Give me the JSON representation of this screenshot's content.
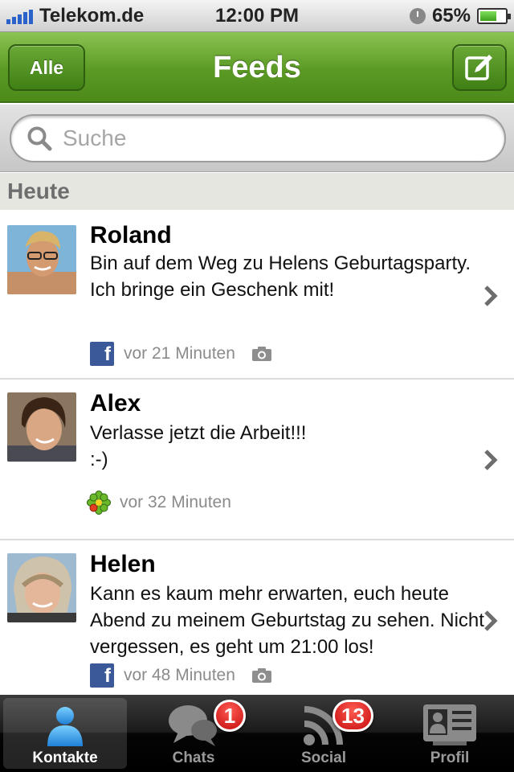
{
  "status_bar": {
    "carrier": "Telekom.de",
    "time": "12:00 PM",
    "battery": "65%",
    "battery_level": 0.65
  },
  "nav": {
    "left_button": "Alle",
    "title": "Feeds",
    "right_icon": "compose-icon"
  },
  "search": {
    "placeholder": "Suche",
    "value": ""
  },
  "section": {
    "title": "Heute"
  },
  "feed": [
    {
      "name": "Roland",
      "message": "Bin auf dem Weg zu Helens Geburtagsparty. Ich bringe ein Geschenk mit!",
      "time": "vor 21 Minuten",
      "source_icon": "facebook-icon",
      "has_photo": true
    },
    {
      "name": "Alex",
      "message": "Verlasse jetzt die Arbeit!!!\n:-)",
      "time": "vor 32 Minuten",
      "source_icon": "icq-flower-icon",
      "has_photo": false
    },
    {
      "name": "Helen",
      "message": "Kann es kaum mehr erwarten, euch heute Abend zu meinem Geburtstag zu sehen. Nicht vergessen, es geht um 21:00 los!",
      "time": "vor 48 Minuten",
      "source_icon": "facebook-icon",
      "has_photo": true
    }
  ],
  "tabs": [
    {
      "label": "Kontakte",
      "icon": "contacts-icon",
      "active": true,
      "badge": ""
    },
    {
      "label": "Chats",
      "icon": "chat-bubbles-icon",
      "active": false,
      "badge": "1"
    },
    {
      "label": "Social",
      "icon": "rss-feed-icon",
      "active": false,
      "badge": "13"
    },
    {
      "label": "Profil",
      "icon": "profile-card-icon",
      "active": false,
      "badge": ""
    }
  ],
  "colors": {
    "nav_green": "#5a9a24",
    "badge_red": "#d01010",
    "facebook_blue": "#3b5998"
  }
}
